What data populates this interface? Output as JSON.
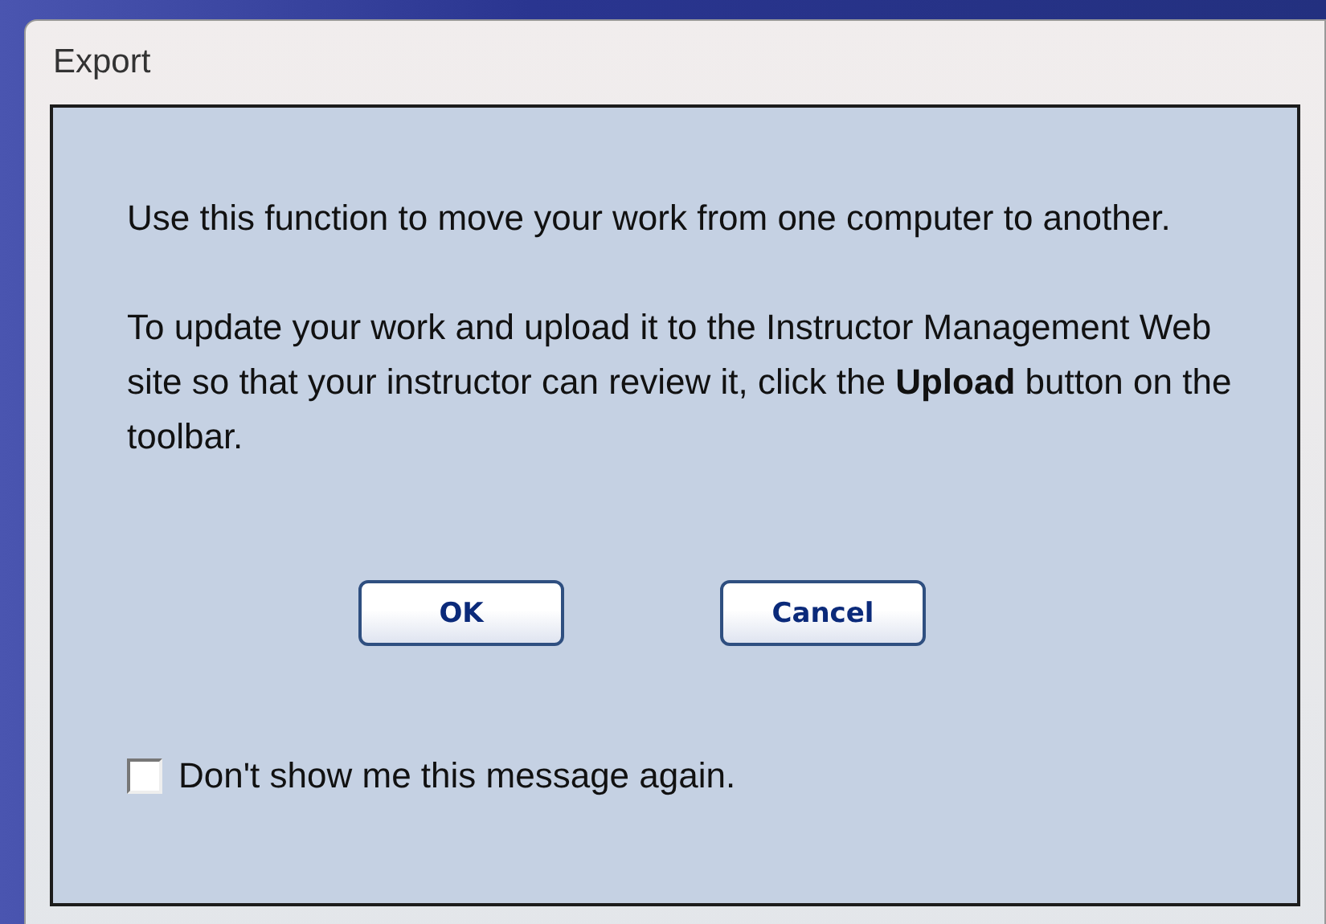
{
  "window": {
    "title": "Export"
  },
  "paragraphs": [
    "Use this function to move your work from one computer to another.",
    "To update your work and upload it to the Instructor Management Web site so that your instructor can review it, click the **Upload** button on the toolbar."
  ],
  "buttons": [
    "OK",
    "Cancel"
  ],
  "checkbox": {
    "label": "Don't show me this message again.",
    "checked": false
  }
}
